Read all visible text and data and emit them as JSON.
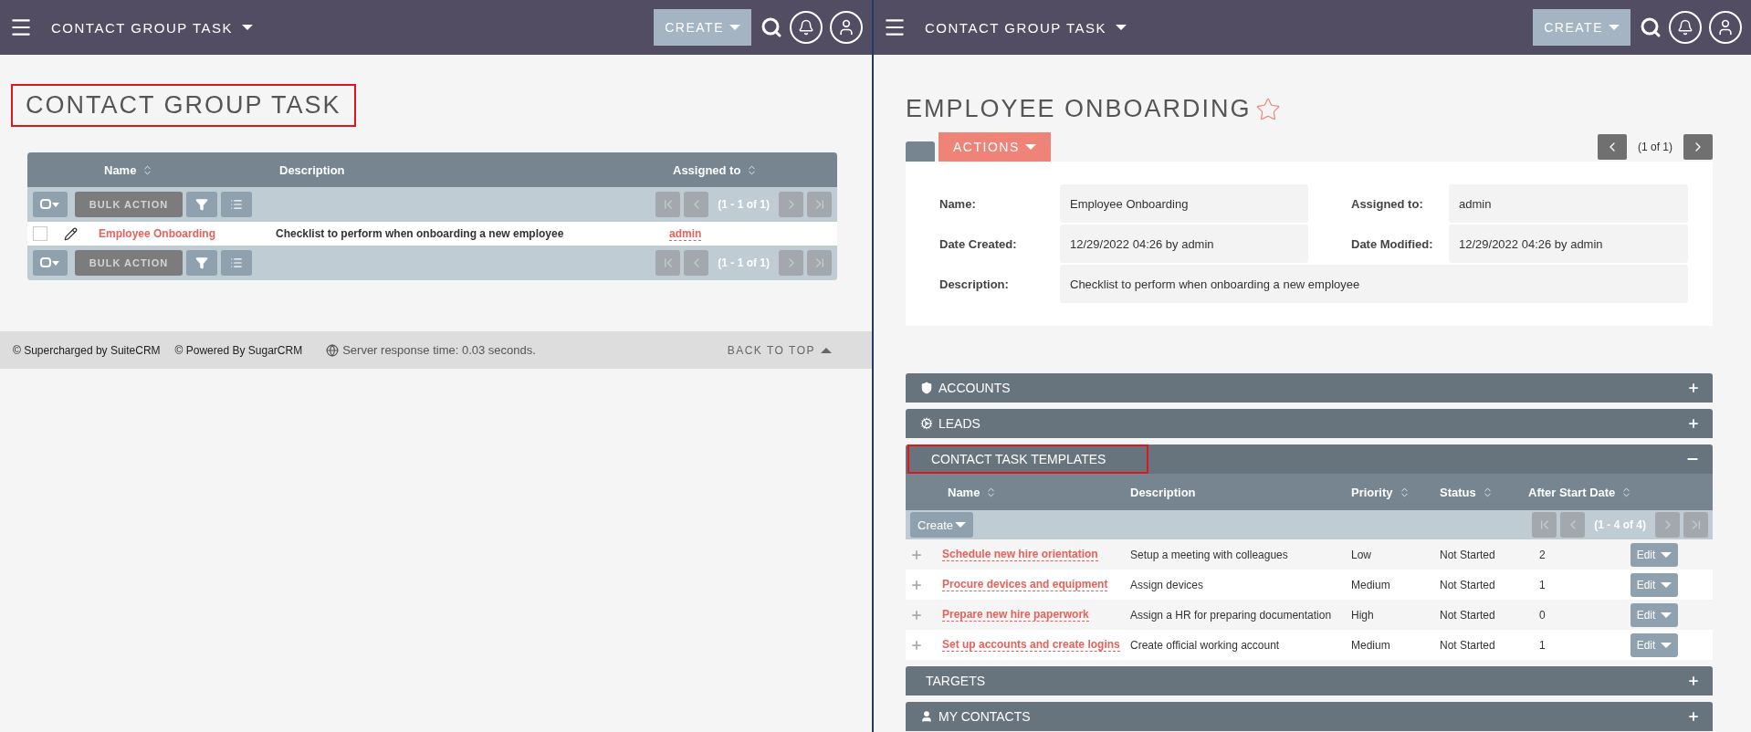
{
  "left_page": {
    "header": {
      "module": "CONTACT GROUP TASK",
      "create": "CREATE"
    },
    "title": {
      "text": "CONTACT GROUP TASK",
      "highlighted": true
    },
    "list": {
      "columns": [
        {
          "label": "Name",
          "sortable": true
        },
        {
          "label": "Description",
          "sortable": false
        },
        {
          "label": "Assigned to",
          "sortable": true
        }
      ],
      "toolbars": [
        {
          "bulk_action": "BULK ACTION",
          "pagination": "(1 - 1 of 1)"
        },
        {
          "bulk_action": "BULK ACTION",
          "pagination": "(1 - 1 of 1)"
        }
      ],
      "rows": [
        {
          "name": "Employee Onboarding",
          "description": "Checklist to perform when onboarding a new employee",
          "assigned_to": "admin",
          "checked": false
        }
      ]
    },
    "footer": {
      "credits": [
        "© Supercharged by SuiteCRM",
        "© Powered By SugarCRM"
      ],
      "server_time": "Server response time: 0.03 seconds.",
      "back_to_top": "BACK TO TOP"
    }
  },
  "right_page": {
    "header": {
      "module": "CONTACT GROUP TASK",
      "create": "CREATE"
    },
    "title": {
      "text": "EMPLOYEE ONBOARDING",
      "favorite": false
    },
    "actions": "ACTIONS",
    "pagination": "(1 of 1)",
    "fields": [
      {
        "label": "Name:",
        "value": "Employee Onboarding",
        "kind": "half"
      },
      {
        "label": "Assigned to:",
        "value": "admin",
        "kind": "half"
      },
      {
        "label": "Date Created:",
        "value": "12/29/2022 04:26 by admin",
        "kind": "half"
      },
      {
        "label": "Date Modified:",
        "value": "12/29/2022 04:26 by admin",
        "kind": "half"
      },
      {
        "label": "Description:",
        "value": "Checklist to perform when onboarding a new employee",
        "kind": "full"
      }
    ],
    "subpanels": [
      {
        "title": "ACCOUNTS",
        "expanded": false,
        "highlighted": false
      },
      {
        "title": "LEADS",
        "expanded": false,
        "highlighted": false
      },
      {
        "title": "CONTACT TASK TEMPLATES",
        "expanded": true,
        "highlighted": true,
        "columns": [
          {
            "label": "Name",
            "sortable": true
          },
          {
            "label": "Description",
            "sortable": false
          },
          {
            "label": "Priority",
            "sortable": true
          },
          {
            "label": "Status",
            "sortable": true
          },
          {
            "label": "After Start Date",
            "sortable": true
          }
        ],
        "create": "Create",
        "pagination": "(1 - 4 of 4)",
        "rows": [
          {
            "name": "Schedule new hire orientation",
            "description": "Setup a meeting with colleagues",
            "priority": "Low",
            "status": "Not Started",
            "after_start_date": "2",
            "edit": "Edit"
          },
          {
            "name": "Procure devices and equipment",
            "description": "Assign devices",
            "priority": "Medium",
            "status": "Not Started",
            "after_start_date": "1",
            "edit": "Edit"
          },
          {
            "name": "Prepare new hire paperwork",
            "description": "Assign a HR for preparing documentation",
            "priority": "High",
            "status": "Not Started",
            "after_start_date": "0",
            "edit": "Edit"
          },
          {
            "name": "Set up accounts and create logins",
            "description": "Create official working account",
            "priority": "Medium",
            "status": "Not Started",
            "after_start_date": "1",
            "edit": "Edit"
          }
        ]
      },
      {
        "title": "TARGETS",
        "expanded": false,
        "highlighted": false
      },
      {
        "title": "MY CONTACTS",
        "expanded": false,
        "highlighted": false
      }
    ]
  }
}
